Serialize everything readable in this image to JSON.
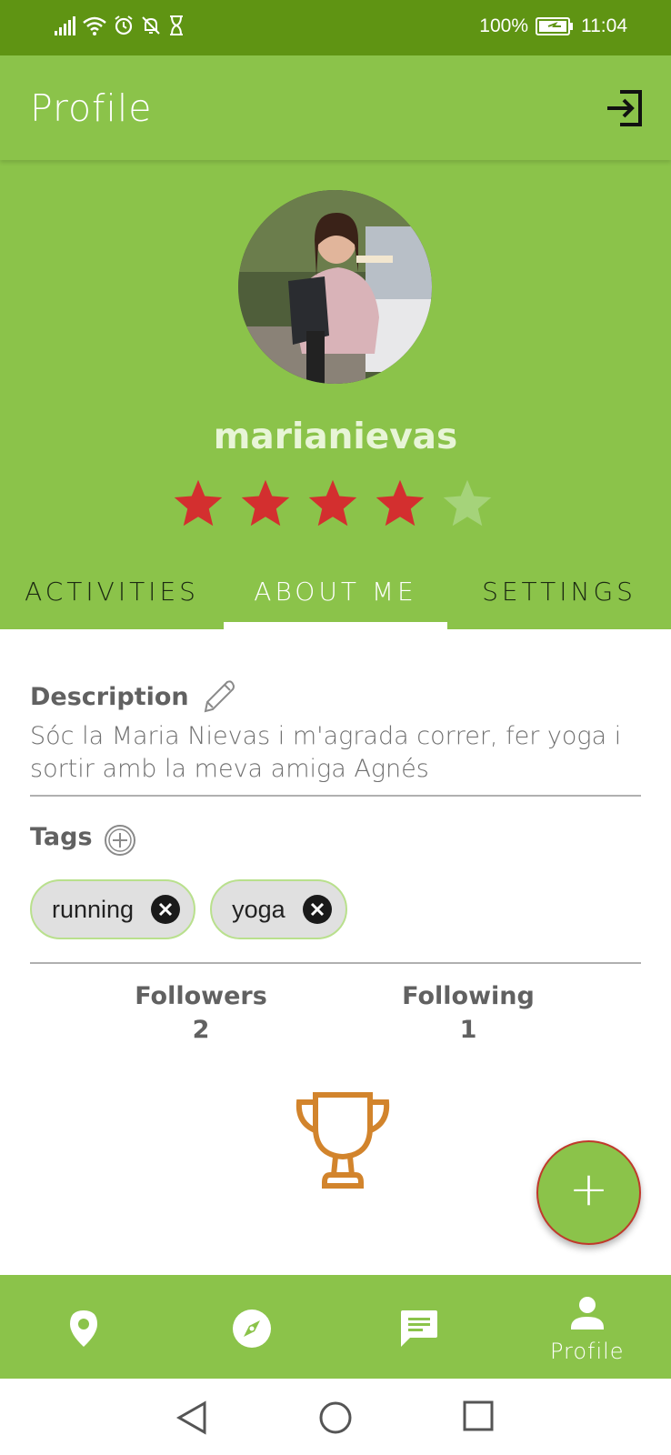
{
  "status_bar": {
    "battery": "100%",
    "time": "11:04"
  },
  "app_bar": {
    "title": "Profile",
    "logout_icon": "logout-icon"
  },
  "profile": {
    "username": "marianievas",
    "rating": 4,
    "rating_max": 5,
    "star_color_filled": "#d32f2f",
    "star_color_empty": "#a5d37a"
  },
  "tabs": [
    {
      "label": "ACTIVITIES",
      "active": false
    },
    {
      "label": "ABOUT ME",
      "active": true
    },
    {
      "label": "SETTINGS",
      "active": false
    }
  ],
  "about": {
    "description_title": "Description",
    "description_text": "Sóc la Maria Nievas i m'agrada correr, fer yoga i sortir amb la meva amiga Agnés",
    "tags_title": "Tags",
    "tags": [
      "running",
      "yoga"
    ],
    "followers_label": "Followers",
    "followers_count": "2",
    "following_label": "Following",
    "following_count": "1"
  },
  "fab": {
    "label": "+"
  },
  "bottom_nav": [
    {
      "icon": "map-pin-icon",
      "label": ""
    },
    {
      "icon": "compass-icon",
      "label": ""
    },
    {
      "icon": "chat-icon",
      "label": ""
    },
    {
      "icon": "person-icon",
      "label": "Profile"
    }
  ],
  "colors": {
    "primary": "#8bc34a",
    "primary_dark": "#5f9413",
    "trophy": "#d2842c"
  }
}
